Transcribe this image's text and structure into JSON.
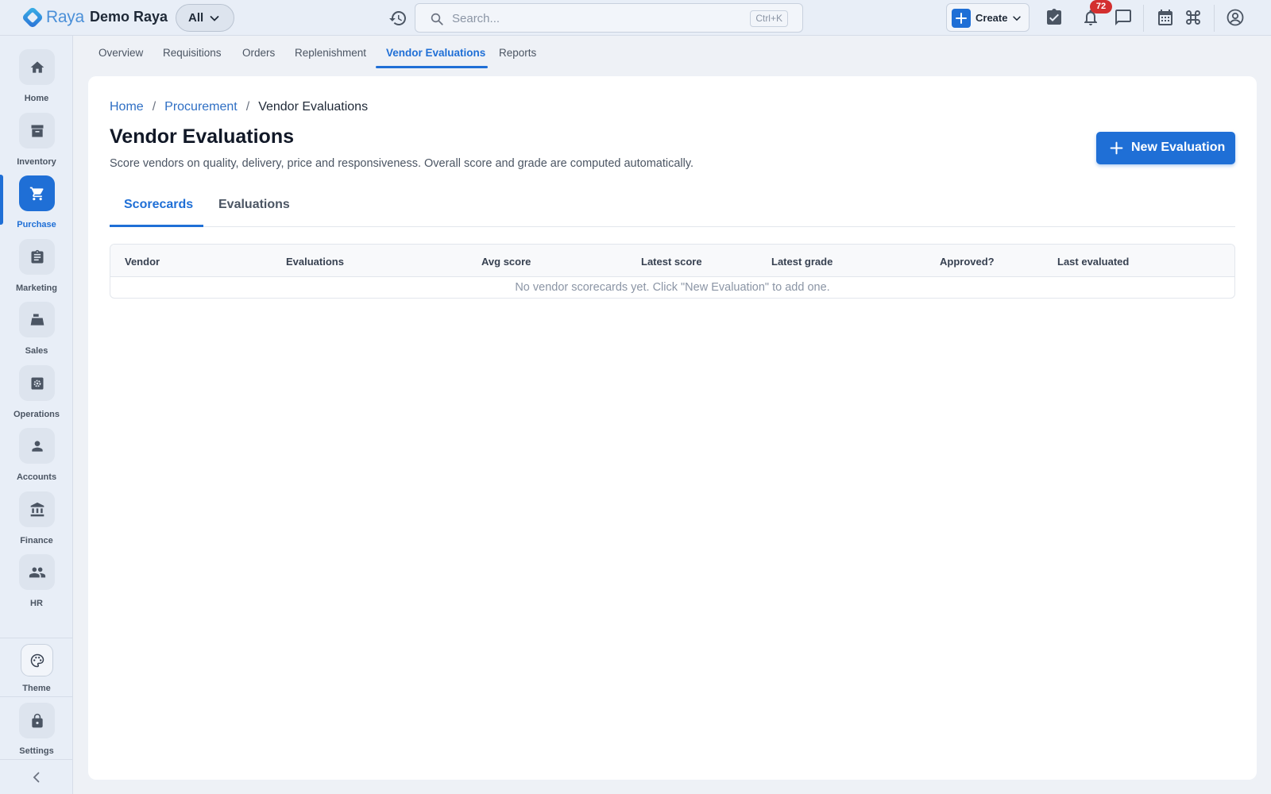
{
  "header": {
    "brand": "Raya",
    "company": "Demo Raya",
    "scope": "All",
    "search_placeholder": "Search...",
    "search_shortcut": "Ctrl+K",
    "create_label": "Create",
    "notification_count": "72"
  },
  "sidebar": {
    "items": [
      {
        "label": "Home",
        "icon": "home-icon"
      },
      {
        "label": "Inventory",
        "icon": "archive-icon"
      },
      {
        "label": "Purchase",
        "icon": "cart-icon",
        "active": true
      },
      {
        "label": "Marketing",
        "icon": "clipboard-icon"
      },
      {
        "label": "Sales",
        "icon": "cash-register-icon"
      },
      {
        "label": "Operations",
        "icon": "gear-box-icon"
      },
      {
        "label": "Accounts",
        "icon": "person-icon"
      },
      {
        "label": "Finance",
        "icon": "bank-icon"
      },
      {
        "label": "HR",
        "icon": "people-icon"
      }
    ],
    "theme_label": "Theme",
    "settings_label": "Settings"
  },
  "subnav": {
    "tabs": [
      "Overview",
      "Requisitions",
      "Orders",
      "Replenishment",
      "Vendor Evaluations",
      "Reports"
    ],
    "active": "Vendor Evaluations"
  },
  "page": {
    "breadcrumb": [
      "Home",
      "Procurement",
      "Vendor Evaluations"
    ],
    "title": "Vendor Evaluations",
    "description": "Score vendors on quality, delivery, price and responsiveness. Overall score and grade are computed automatically.",
    "new_button": "New Evaluation",
    "tabs": [
      "Scorecards",
      "Evaluations"
    ],
    "active_tab": "Scorecards"
  },
  "table": {
    "columns": [
      "Vendor",
      "Evaluations",
      "Avg score",
      "Latest score",
      "Latest grade",
      "Approved?",
      "Last evaluated"
    ],
    "empty_message": "No vendor scorecards yet. Click \"New Evaluation\" to add one."
  },
  "colors": {
    "accent": "#1f6fd6",
    "badge": "#d32f2f",
    "brand": "#4a8fd8"
  }
}
